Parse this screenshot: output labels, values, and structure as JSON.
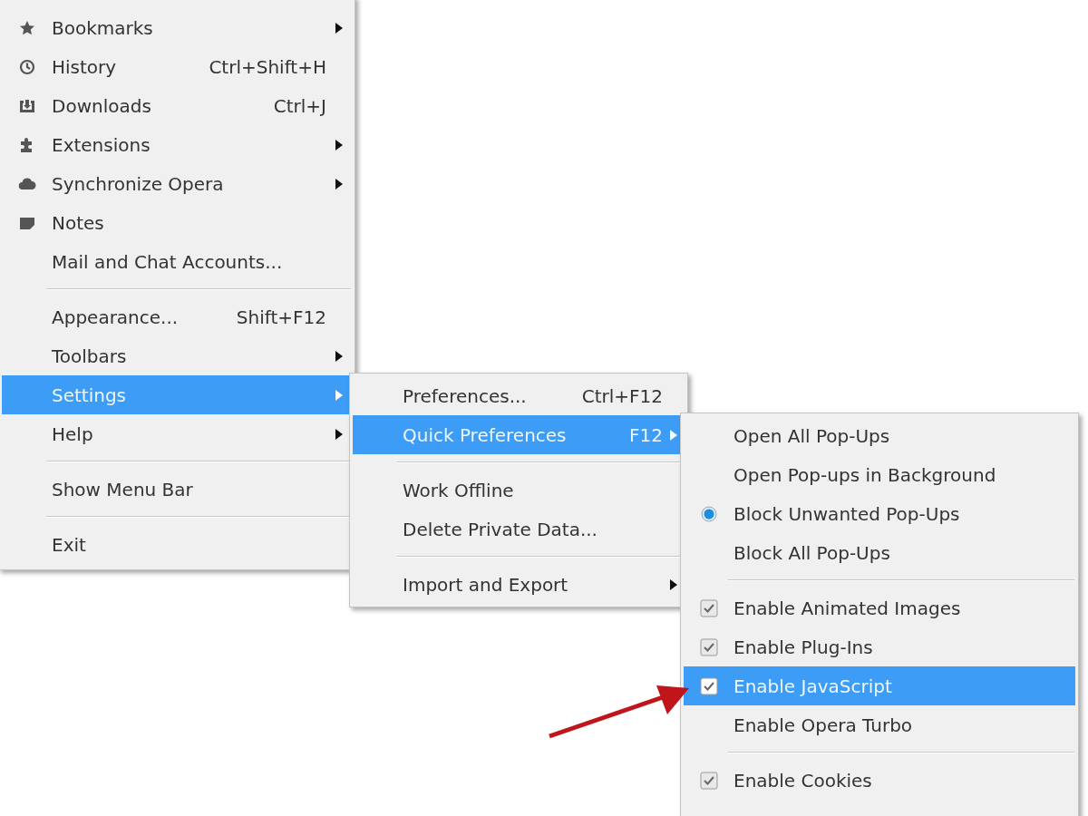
{
  "menus": [
    {
      "items": [
        {
          "kind": "item",
          "label": "Bookmarks",
          "submenu": true,
          "selected": false
        },
        {
          "kind": "item",
          "label": "History",
          "shortcut": "Ctrl+Shift+H",
          "submenu": false,
          "selected": false
        },
        {
          "kind": "item",
          "label": "Downloads",
          "shortcut": "Ctrl+J",
          "submenu": false,
          "selected": false
        },
        {
          "kind": "item",
          "label": "Extensions",
          "submenu": true,
          "selected": false
        },
        {
          "kind": "item",
          "label": "Synchronize Opera",
          "submenu": true,
          "selected": false
        },
        {
          "kind": "item",
          "label": "Notes",
          "submenu": false,
          "selected": false
        },
        {
          "kind": "item",
          "label": "Mail and Chat Accounts...",
          "submenu": false,
          "selected": false
        },
        {
          "kind": "separator"
        },
        {
          "kind": "item",
          "label": "Appearance...",
          "shortcut": "Shift+F12",
          "submenu": false,
          "selected": false
        },
        {
          "kind": "item",
          "label": "Toolbars",
          "submenu": true,
          "selected": false
        },
        {
          "kind": "item",
          "label": "Settings",
          "submenu": true,
          "selected": true
        },
        {
          "kind": "item",
          "label": "Help",
          "submenu": true,
          "selected": false
        },
        {
          "kind": "separator"
        },
        {
          "kind": "item",
          "label": "Show Menu Bar",
          "submenu": false,
          "selected": false
        },
        {
          "kind": "separator"
        },
        {
          "kind": "item",
          "label": "Exit",
          "submenu": false,
          "selected": false
        }
      ]
    },
    {
      "items": [
        {
          "kind": "item",
          "label": "Preferences...",
          "shortcut": "Ctrl+F12",
          "submenu": false,
          "selected": false
        },
        {
          "kind": "item",
          "label": "Quick Preferences",
          "shortcut": "F12",
          "submenu": true,
          "selected": true
        },
        {
          "kind": "separator"
        },
        {
          "kind": "item",
          "label": "Work Offline",
          "submenu": false,
          "selected": false
        },
        {
          "kind": "item",
          "label": "Delete Private Data...",
          "submenu": false,
          "selected": false
        },
        {
          "kind": "separator"
        },
        {
          "kind": "item",
          "label": "Import and Export",
          "submenu": true,
          "selected": false
        }
      ]
    },
    {
      "items": [
        {
          "kind": "radio",
          "label": "Open All Pop-Ups",
          "checked": false,
          "selected": false
        },
        {
          "kind": "radio",
          "label": "Open Pop-ups in Background",
          "checked": false,
          "selected": false
        },
        {
          "kind": "radio",
          "label": "Block Unwanted Pop-Ups",
          "checked": true,
          "selected": false
        },
        {
          "kind": "radio",
          "label": "Block All Pop-Ups",
          "checked": false,
          "selected": false
        },
        {
          "kind": "separator"
        },
        {
          "kind": "check",
          "label": "Enable Animated Images",
          "checked": true,
          "selected": false
        },
        {
          "kind": "check",
          "label": "Enable Plug-Ins",
          "checked": true,
          "selected": false
        },
        {
          "kind": "check",
          "label": "Enable JavaScript",
          "checked": true,
          "selected": true
        },
        {
          "kind": "check",
          "label": "Enable Opera Turbo",
          "checked": false,
          "selected": false
        },
        {
          "kind": "separator"
        },
        {
          "kind": "check",
          "label": "Enable Cookies",
          "checked": true,
          "selected": false
        }
      ]
    }
  ]
}
